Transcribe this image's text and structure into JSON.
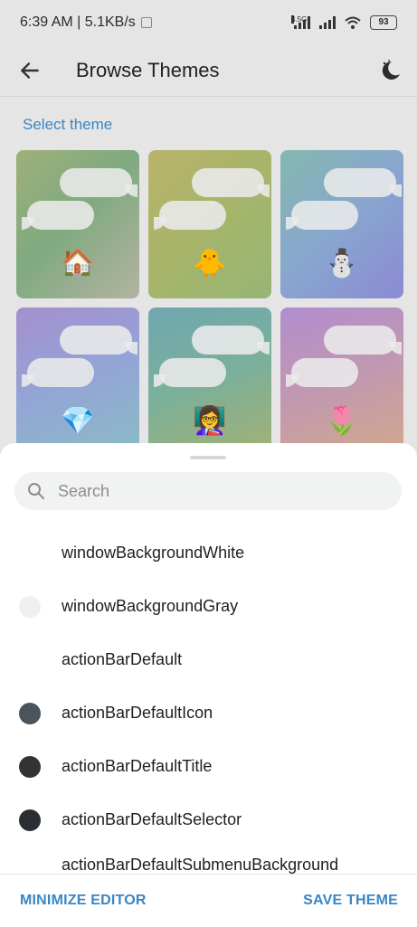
{
  "status_bar": {
    "time_speed": "6:39 AM | 5.1KB/s",
    "network_label": "4.5G",
    "battery": "93"
  },
  "header": {
    "title": "Browse Themes"
  },
  "section": {
    "label": "Select theme"
  },
  "themes": [
    {
      "emoji": "🏠",
      "name": "house"
    },
    {
      "emoji": "🐥",
      "name": "chick"
    },
    {
      "emoji": "⛄",
      "name": "snowman"
    },
    {
      "emoji": "💎",
      "name": "diamond"
    },
    {
      "emoji": "👩‍🏫",
      "name": "teacher"
    },
    {
      "emoji": "🌷",
      "name": "tulip"
    }
  ],
  "editor": {
    "search_placeholder": "Search",
    "items": [
      {
        "label": "windowBackgroundWhite",
        "color": null
      },
      {
        "label": "windowBackgroundGray",
        "color": "#f0f0f0"
      },
      {
        "label": "actionBarDefault",
        "color": null
      },
      {
        "label": "actionBarDefaultIcon",
        "color": "#4a545c"
      },
      {
        "label": "actionBarDefaultTitle",
        "color": "#333333"
      },
      {
        "label": "actionBarDefaultSelector",
        "color": "#2b2f33"
      },
      {
        "label": "actionBarDefaultSubmenuBackground",
        "color": null
      }
    ],
    "minimize_label": "MINIMIZE EDITOR",
    "save_label": "SAVE THEME"
  },
  "colors": {
    "accent": "#3a86c4"
  }
}
